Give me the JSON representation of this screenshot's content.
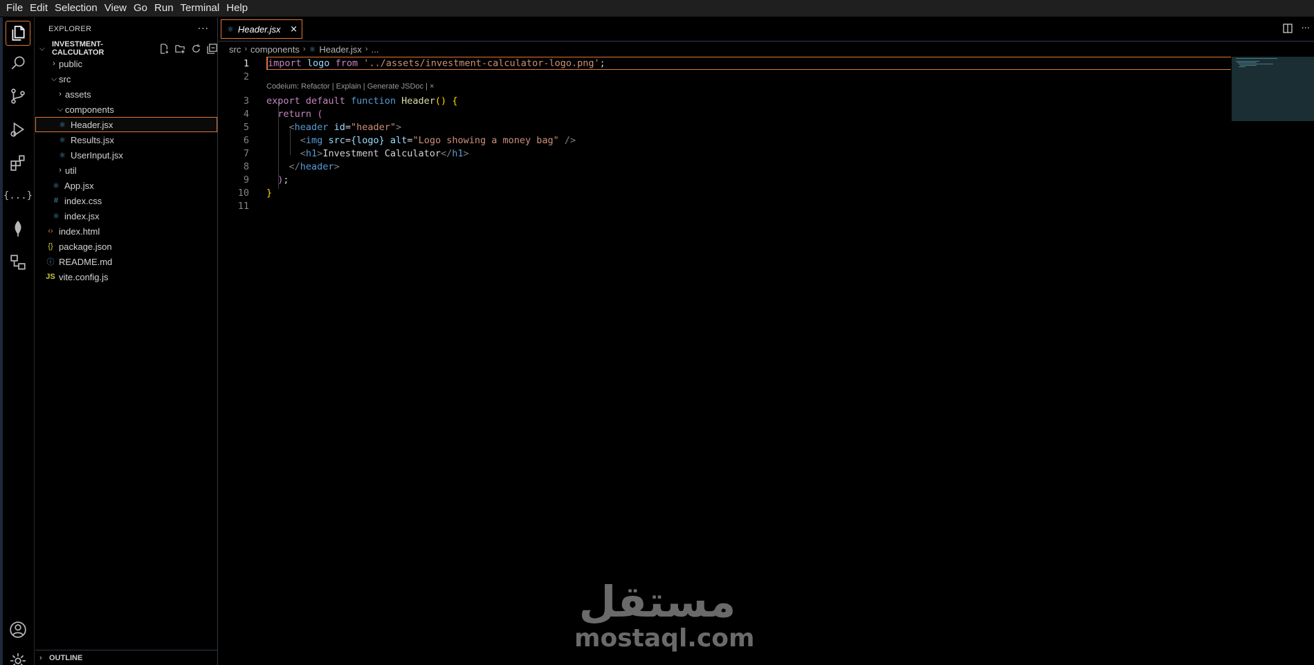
{
  "menubar": {
    "items": [
      "File",
      "Edit",
      "Selection",
      "View",
      "Go",
      "Run",
      "Terminal",
      "Help"
    ]
  },
  "activitybar": {
    "icons": [
      "files-icon",
      "search-icon",
      "source-control-icon",
      "run-debug-icon",
      "extensions-icon",
      "json-braces-icon",
      "mongodb-leaf-icon",
      "remote-explorer-icon",
      "account-icon",
      "settings-gear-icon"
    ],
    "braces_glyph": "{...}"
  },
  "sidebar": {
    "title": "EXPLORER",
    "more": "···",
    "project": "INVESTMENT-CALCULATOR",
    "tree": [
      {
        "label": "public",
        "type": "folder",
        "expanded": false
      },
      {
        "label": "src",
        "type": "folder",
        "expanded": true
      },
      {
        "label": "assets",
        "type": "folder",
        "expanded": false
      },
      {
        "label": "components",
        "type": "folder",
        "expanded": true
      },
      {
        "label": "Header.jsx",
        "type": "react",
        "selected": true
      },
      {
        "label": "Results.jsx",
        "type": "react"
      },
      {
        "label": "UserInput.jsx",
        "type": "react"
      },
      {
        "label": "util",
        "type": "folder",
        "expanded": false
      },
      {
        "label": "App.jsx",
        "type": "react"
      },
      {
        "label": "index.css",
        "type": "css"
      },
      {
        "label": "index.jsx",
        "type": "react"
      },
      {
        "label": "index.html",
        "type": "html"
      },
      {
        "label": "package.json",
        "type": "json"
      },
      {
        "label": "README.md",
        "type": "info"
      },
      {
        "label": "vite.config.js",
        "type": "js"
      }
    ],
    "outline": "OUTLINE"
  },
  "tabs": [
    {
      "label": "Header.jsx",
      "close": "×"
    }
  ],
  "breadcrumb": {
    "parts": [
      "src",
      "components",
      "Header.jsx",
      "..."
    ]
  },
  "editor": {
    "codelens": "Codeium: Refactor | Explain | Generate JSDoc | ×",
    "line_numbers": [
      "1",
      "2",
      "3",
      "4",
      "5",
      "6",
      "7",
      "8",
      "9",
      "10",
      "11"
    ],
    "lines": {
      "l1": {
        "import": "import",
        "logo": "logo",
        "from": "from",
        "path": "'../assets/investment-calculator-logo.png'",
        "semi": ";"
      },
      "l3": {
        "export": "export",
        "default": "default",
        "function": "function",
        "name": "Header",
        "parens": "()",
        "brace": "{"
      },
      "l4": {
        "return": "return",
        "paren": "("
      },
      "l5": {
        "open": "<",
        "tag": "header",
        "attr": "id",
        "eq": "=",
        "val": "\"header\"",
        "close": ">"
      },
      "l6": {
        "open": "<",
        "tag": "img",
        "attr1": "src",
        "eq1": "=",
        "expr": "{logo}",
        "attr2": "alt",
        "eq2": "=",
        "val": "\"Logo showing a money bag\"",
        "close": " />"
      },
      "l7": {
        "open": "<",
        "tag": "h1",
        "gt": ">",
        "text": "Investment Calculator",
        "endopen": "</",
        "endtag": "h1",
        "endgt": ">"
      },
      "l8": {
        "open": "</",
        "tag": "header",
        "close": ">"
      },
      "l9": {
        "paren": ")",
        "semi": ";"
      },
      "l10": {
        "brace": "}"
      }
    }
  },
  "watermark": {
    "arabic": "مستقل",
    "latin": "mostaql.com"
  },
  "colors": {
    "accent": "#e37933",
    "react_icon": "#519aba",
    "keyword": "#569cd6",
    "control_keyword": "#c586c0",
    "string": "#ce9178",
    "function": "#dcdcaa"
  }
}
